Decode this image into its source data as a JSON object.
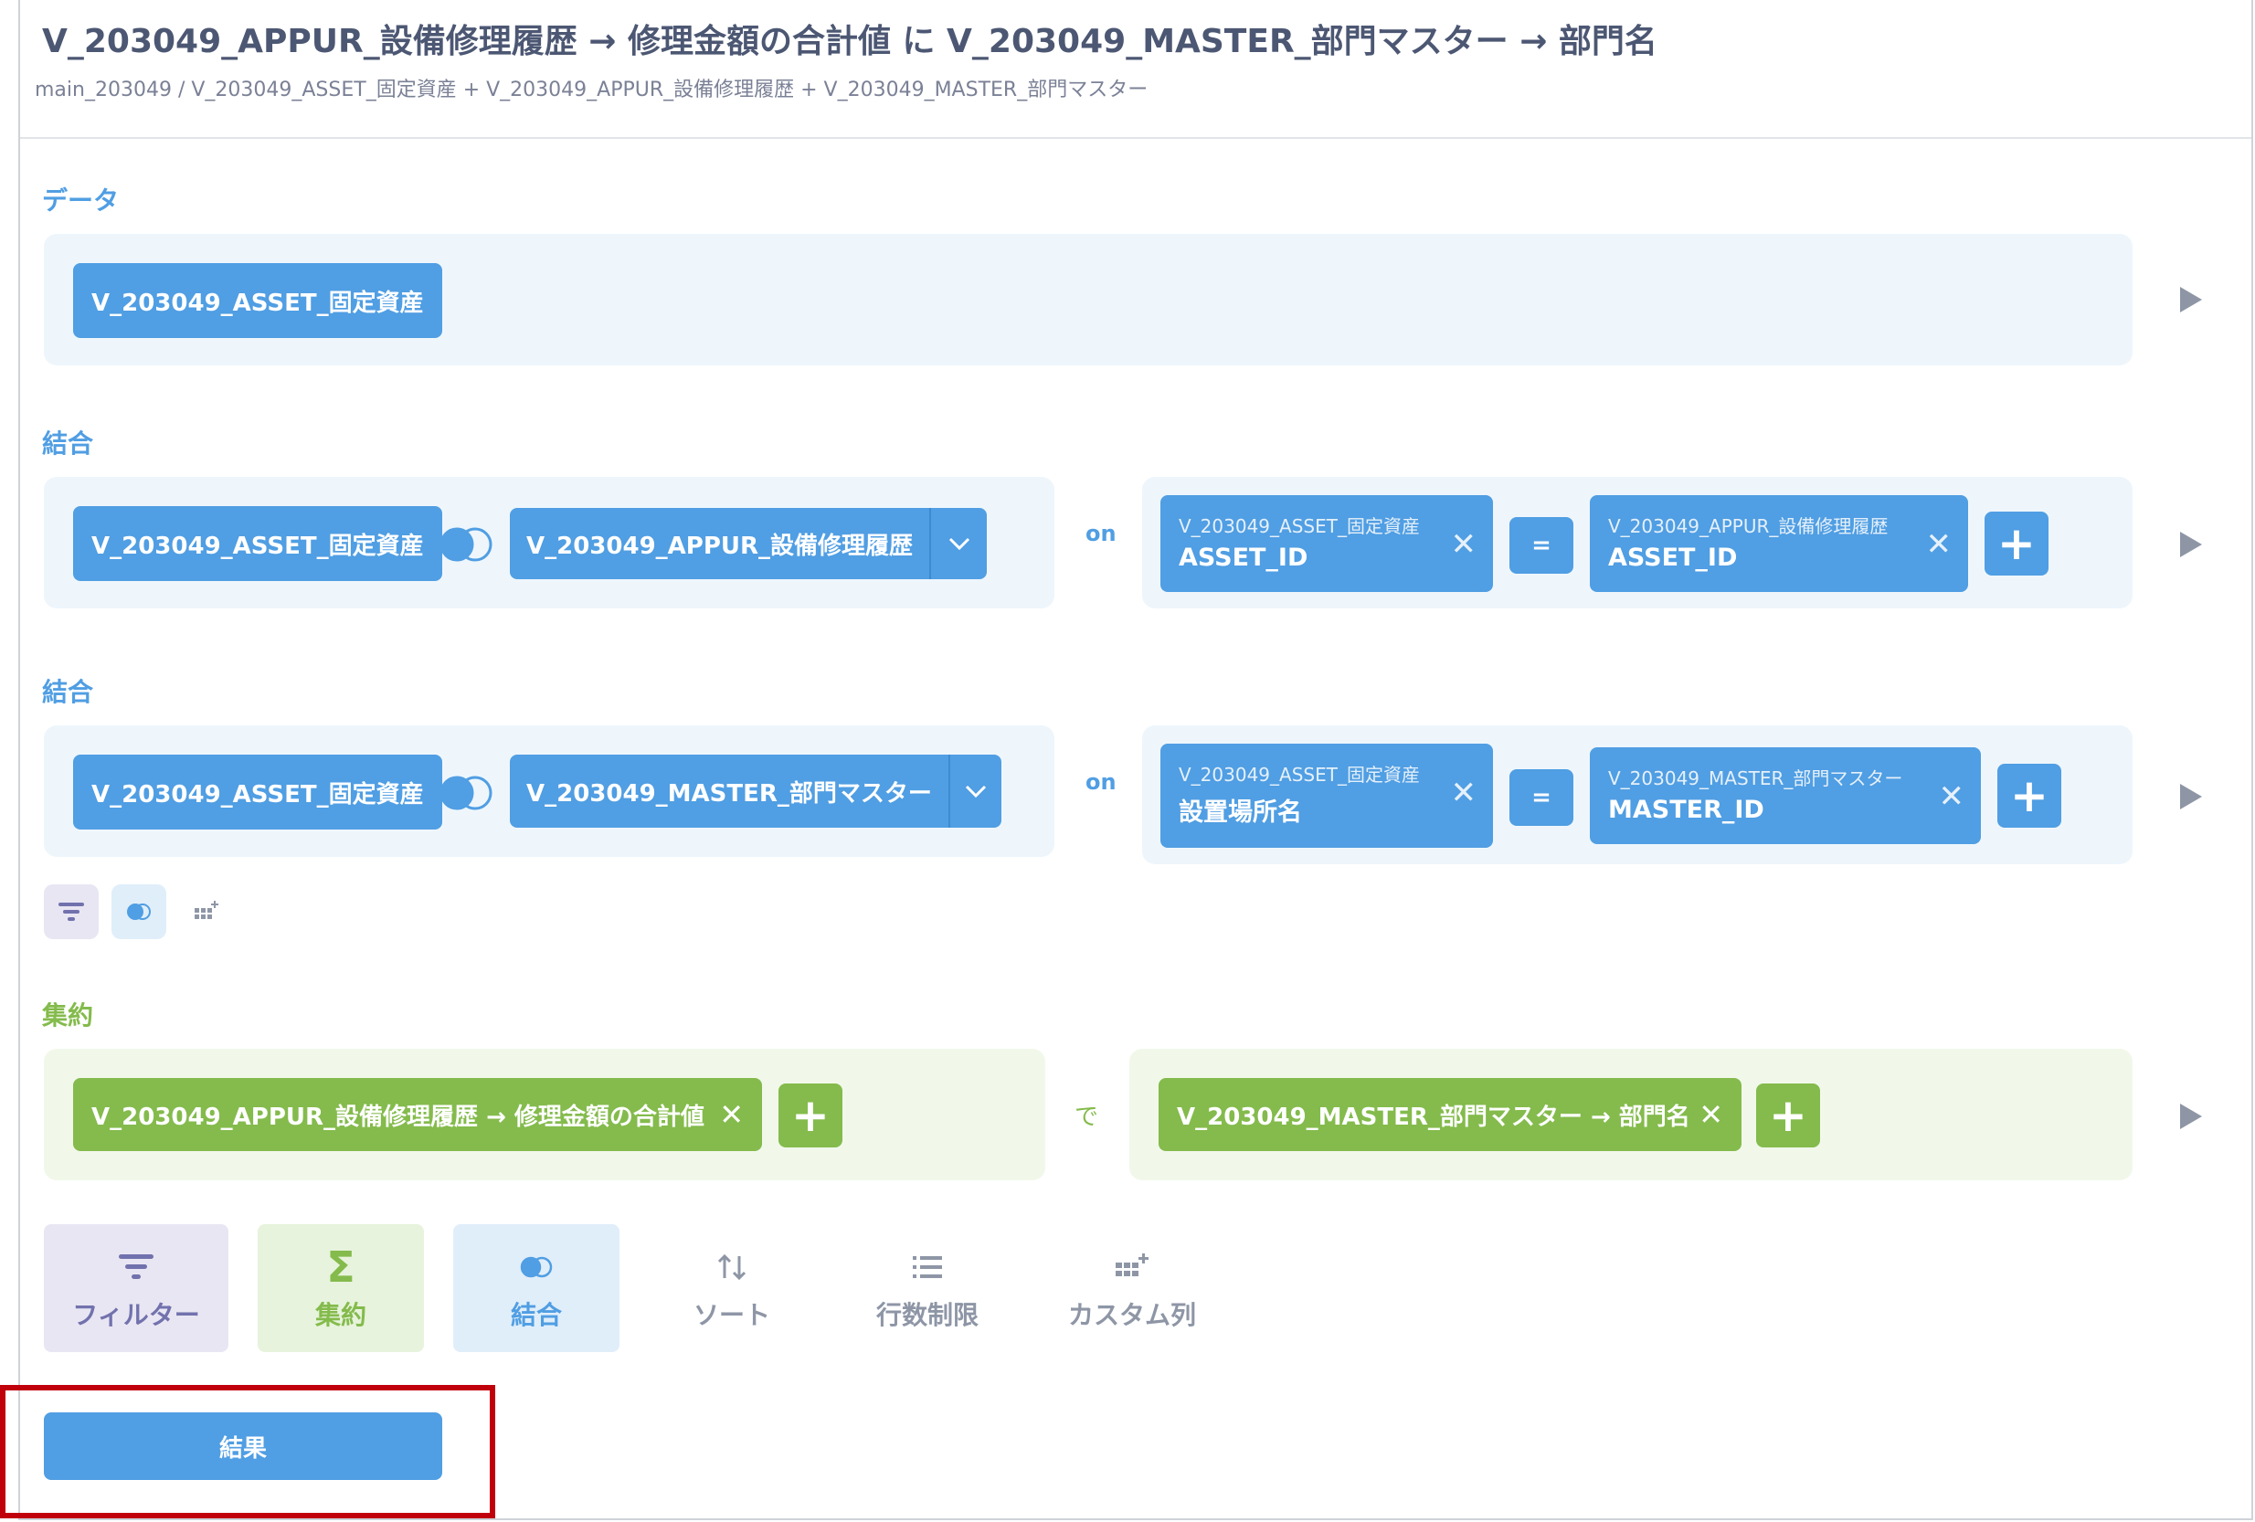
{
  "header": {
    "title": "V_203049_APPUR_設備修理履歴 → 修理金額の合計値 に V_203049_MASTER_部門マスター → 部門名",
    "breadcrumb": "main_203049 /  V_203049_ASSET_固定資産 + V_203049_APPUR_設備修理履歴 + V_203049_MASTER_部門マスター"
  },
  "data_section": {
    "label": "データ",
    "table": "V_203049_ASSET_固定資産"
  },
  "joins": [
    {
      "label": "結合",
      "left_table": "V_203049_ASSET_固定資産",
      "right_table": "V_203049_APPUR_設備修理履歴",
      "on": "on",
      "left_col_table": "V_203049_ASSET_固定資産",
      "left_col": "ASSET_ID",
      "equals": "=",
      "right_col_table": "V_203049_APPUR_設備修理履歴",
      "right_col": "ASSET_ID"
    },
    {
      "label": "結合",
      "left_table": "V_203049_ASSET_固定資産",
      "right_table": "V_203049_MASTER_部門マスター",
      "on": "on",
      "left_col_table": "V_203049_ASSET_固定資産",
      "left_col": "設置場所名",
      "equals": "=",
      "right_col_table": "V_203049_MASTER_部門マスター",
      "right_col": "MASTER_ID"
    }
  ],
  "summarize": {
    "label": "集約",
    "metric": "V_203049_APPUR_設備修理履歴 → 修理金額の合計値",
    "by": "で",
    "breakout": "V_203049_MASTER_部門マスター → 部門名"
  },
  "actions": {
    "filter": "フィルター",
    "summarize": "集約",
    "join": "結合",
    "sort": "ソート",
    "limit": "行数制限",
    "custom_column": "カスタム列"
  },
  "result_button": "結果",
  "colors": {
    "brand_blue": "#509ee3",
    "summarize_green": "#84bb4c",
    "highlight_red": "#c0000b"
  },
  "icons": [
    "join-icon",
    "filter-icon",
    "sigma-icon",
    "sort-icon",
    "list-icon",
    "custom-column-icon",
    "plus-icon",
    "close-icon",
    "chevron-down-icon",
    "play-icon"
  ]
}
